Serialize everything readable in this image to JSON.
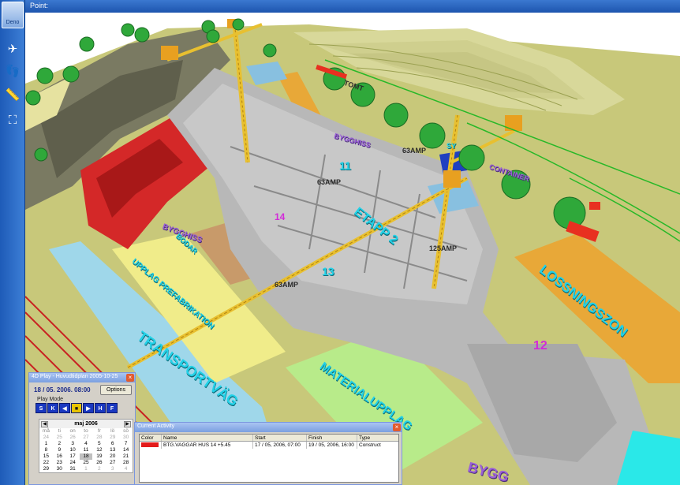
{
  "header": {
    "title": "Point:",
    "logo_text": "Deno"
  },
  "toolbar": {
    "icons": [
      "plane-icon",
      "footprints-icon",
      "ruler-icon",
      "fit-view-icon"
    ]
  },
  "scene": {
    "labels": {
      "transportvag": "TRANSPORTVÄG",
      "materialupplag": "MATERIALUPPLAG",
      "upplag": "UPPLAG PREFABRIKATION",
      "lossningszon": "LOSSNINGSZON",
      "bygghiss": "BYGGHISS",
      "bygghiss2": "BYGGHISS",
      "bygghiss3": "BYGG",
      "bodar": "BODAR",
      "tomt": "TOMT",
      "container": "CONTAINER",
      "sy": "SY",
      "etapp2": "ETAPP 2",
      "amp1": "63AMP",
      "amp2": "125AMP",
      "amp3": "63AMP",
      "amp4": "63AMP",
      "num1": "12",
      "num2": "13",
      "num3": "14",
      "num4": "11"
    }
  },
  "play_window": {
    "title": "4D Play - Huvudtidplan 2005-10-25",
    "date": "18 / 05. 2006. 08:00",
    "options_label": "Options",
    "play_mode_label": "Play Mode",
    "buttons": [
      "S",
      "K",
      "◀",
      "■",
      "▶",
      "H",
      "F"
    ],
    "calendar": {
      "month": "maj 2006",
      "day_headers": [
        "må",
        "ti",
        "on",
        "to",
        "fr",
        "lö",
        "sö"
      ],
      "days": [
        "24",
        "25",
        "26",
        "27",
        "28",
        "29",
        "30",
        "1",
        "2",
        "3",
        "4",
        "5",
        "6",
        "7",
        "8",
        "9",
        "10",
        "11",
        "12",
        "13",
        "14",
        "15",
        "16",
        "17",
        "18",
        "19",
        "20",
        "21",
        "22",
        "23",
        "24",
        "25",
        "26",
        "27",
        "28",
        "29",
        "30",
        "31",
        "1",
        "2",
        "3",
        "4"
      ]
    }
  },
  "activity_window": {
    "title": "Current Activity",
    "columns": [
      "Color",
      "Name",
      "Start",
      "Finish",
      "Type"
    ],
    "rows": [
      {
        "color": "#e31b1b",
        "name": "BTG.VAGGAR HUS 14 +5.45",
        "start": "17 / 05, 2006, 07:00",
        "finish": "19 / 05, 2006, 16:00",
        "type": "Construct"
      }
    ]
  }
}
